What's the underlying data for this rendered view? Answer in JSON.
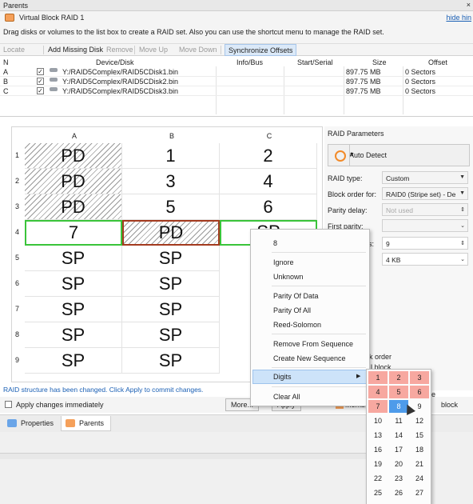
{
  "window": {
    "title": "Parents",
    "close_glyph": "×"
  },
  "header": {
    "name": "Virtual Block RAID 1",
    "hide_link": "hide hin",
    "hint": "Drag disks or volumes to the list box to create a RAID set. Also you can use the shortcut menu to manage the RAID set."
  },
  "toolbar": {
    "locate": "Locate",
    "add_missing": "Add Missing Disk",
    "remove": "Remove",
    "move_up": "Move Up",
    "move_down": "Move Down",
    "sync": "Synchronize Offsets"
  },
  "disk_table": {
    "headers": {
      "n": "N",
      "device": "Device/Disk",
      "info": "Info/Bus",
      "start": "Start/Serial",
      "size": "Size",
      "offset": "Offset"
    },
    "rows": [
      {
        "n": "A",
        "checked": "✓",
        "device": "Y:/RAID5Complex/RAID5CDisk1.bin",
        "size": "897.75 MB",
        "offset": "0 Sectors"
      },
      {
        "n": "B",
        "checked": "✓",
        "device": "Y:/RAID5Complex/RAID5CDisk2.bin",
        "size": "897.75 MB",
        "offset": "0 Sectors"
      },
      {
        "n": "C",
        "checked": "✓",
        "device": "Y:/RAID5Complex/RAID5CDisk3.bin",
        "size": "897.75 MB",
        "offset": "0 Sectors"
      }
    ]
  },
  "grid": {
    "columns": [
      "A",
      "B",
      "C"
    ],
    "rows": [
      {
        "n": "1",
        "cells": [
          "PD",
          "1",
          "2"
        ]
      },
      {
        "n": "2",
        "cells": [
          "PD",
          "3",
          "4"
        ]
      },
      {
        "n": "3",
        "cells": [
          "PD",
          "5",
          "6"
        ]
      },
      {
        "n": "4",
        "cells": [
          "7",
          "PD",
          "SP"
        ]
      },
      {
        "n": "5",
        "cells": [
          "SP",
          "SP",
          ""
        ]
      },
      {
        "n": "6",
        "cells": [
          "SP",
          "SP",
          ""
        ]
      },
      {
        "n": "7",
        "cells": [
          "SP",
          "SP",
          ""
        ]
      },
      {
        "n": "8",
        "cells": [
          "SP",
          "SP",
          ""
        ]
      },
      {
        "n": "9",
        "cells": [
          "SP",
          "SP",
          ""
        ]
      }
    ]
  },
  "raid_params": {
    "title": "RAID Parameters",
    "auto_detect": "Auto Detect",
    "raid_type_label": "RAID type:",
    "raid_type_value": "Custom",
    "block_order_label": "Block order for:",
    "block_order_value": "RAID0 (Stripe set) - De",
    "parity_delay_label": "Parity delay:",
    "parity_delay_value": "Not used",
    "first_parity_label": "First parity:",
    "disks_label_partial": "s:",
    "disks_value": "9",
    "block_size_value": "4 KB",
    "k_order": "k order",
    "block_partial": "l block",
    "e_partial": "e",
    "block_right": "block"
  },
  "status": {
    "message": "RAID structure has been changed. Click Apply to commit changes.",
    "apply_immediately": "Apply changes immediately",
    "more_button": "More...",
    "apply_button": "Apply",
    "member_partial": "Member"
  },
  "tabs": {
    "properties": "Properties",
    "parents": "Parents"
  },
  "context_menu": {
    "value": "8",
    "ignore": "Ignore",
    "unknown": "Unknown",
    "parity_of_data": "Parity Of Data",
    "parity_of_all": "Parity Of All",
    "reed_solomon": "Reed-Solomon",
    "remove_seq": "Remove From Sequence",
    "create_seq": "Create New Sequence",
    "digits": "Digits",
    "clear_all": "Clear All"
  },
  "digits_submenu": {
    "items": [
      "1",
      "2",
      "3",
      "4",
      "5",
      "6",
      "7",
      "8",
      "9",
      "10",
      "11",
      "12",
      "13",
      "14",
      "15",
      "16",
      "17",
      "18",
      "19",
      "20",
      "21",
      "22",
      "23",
      "24",
      "25",
      "26",
      "27"
    ],
    "highlighted_red": [
      "1",
      "2",
      "3",
      "4",
      "5",
      "6",
      "7"
    ],
    "selected": "8"
  },
  "colors": {
    "accent": "#1a5fb4",
    "green_selection": "#3ac43a",
    "red_selection": "#a33a1e",
    "red_cell": "#f7a8a0",
    "selected_digit": "#4e9bea"
  }
}
